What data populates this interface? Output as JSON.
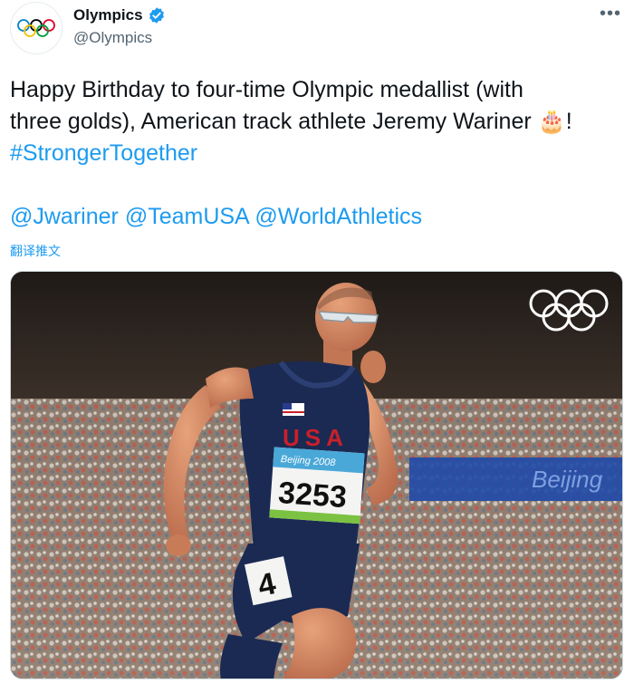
{
  "account": {
    "display_name": "Olympics",
    "handle": "@Olympics",
    "verified": true,
    "avatar_icon": "olympic-rings-icon",
    "more_icon": "more-options-icon"
  },
  "tweet": {
    "line1": "Happy Birthday to four-time Olympic medallist (with",
    "line2": "three golds), American track athlete Jeremy Wariner",
    "emoji_after_line2": "🎂",
    "line2_end": "!",
    "hashtag": "#StrongerTogether",
    "mentions": [
      "@Jwariner",
      "@TeamUSA",
      "@WorldAthletics"
    ],
    "translate_link": "翻译推文"
  },
  "photo": {
    "bib_number": "3253",
    "jersey_text": "USA",
    "bib_event_text": "Beijing 2008",
    "hip_number": "4",
    "banner_text": "Beijing",
    "watermark_icon": "olympic-rings-icon"
  },
  "colors": {
    "link": "#1d9bf0",
    "verified": "#1d9bf0",
    "text": "#0f1419",
    "secondary": "#536471"
  }
}
